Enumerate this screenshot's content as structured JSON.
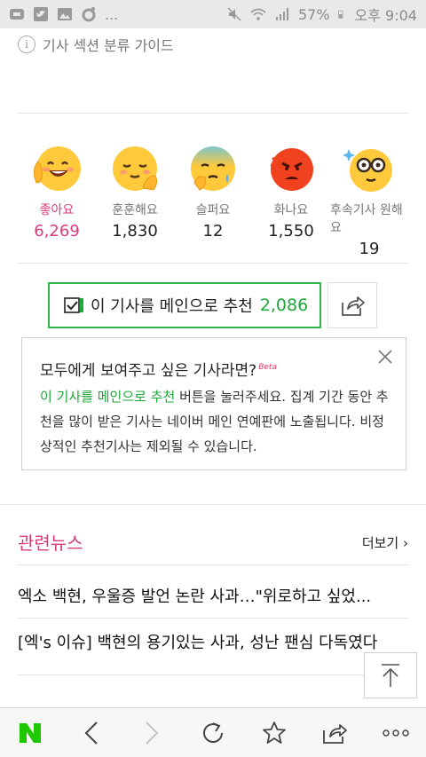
{
  "status_bar": {
    "left_icons": [
      "stick-icon",
      "twitter-icon",
      "image-icon",
      "camera-icon"
    ],
    "ellipsis": "...",
    "battery": "57%",
    "time": "오후 9:04",
    "right_icons": [
      "mute-icon",
      "wifi-icon",
      "signal-icon",
      "battery-icon"
    ]
  },
  "guide": {
    "label": "기사 섹션 분류 가이드"
  },
  "reactions": [
    {
      "label": "좋아요",
      "count": "6,269",
      "icon": "like-face-icon",
      "active": true
    },
    {
      "label": "훈훈해요",
      "count": "1,830",
      "icon": "warm-face-icon",
      "active": false
    },
    {
      "label": "슬퍼요",
      "count": "12",
      "icon": "sad-face-icon",
      "active": false
    },
    {
      "label": "화나요",
      "count": "1,550",
      "icon": "angry-face-icon",
      "active": false
    },
    {
      "label": "후속기사 원해요",
      "count": "19",
      "icon": "glasses-face-icon",
      "active": false
    }
  ],
  "recommend": {
    "label": "이 기사를 메인으로 추천",
    "count": "2,086"
  },
  "info_box": {
    "title": "모두에게 보여주고 싶은 기사라면?",
    "beta": "Beta",
    "highlight": "이 기사를 메인으로 추천",
    "body": " 버튼을 눌러주세요. 집계 기간 동안 추천을 많이 받은 기사는 네이버 메인 연예판에 노출됩니다. 비정상적인 추천기사는 제외될 수 있습니다."
  },
  "related": {
    "title": "관련뉴스",
    "more": "더보기",
    "items": [
      "엑소 백현, 우울증 발언 논란 사과…\"위로하고 싶었...",
      "[엑's 이슈] 백현의 용기있는 사과, 성난 팬심 다독였다"
    ]
  },
  "colors": {
    "accent_pink": "#d93c7b",
    "accent_green": "#1ea83a",
    "naver_green": "#1ec800"
  },
  "bottom_nav": [
    "naver-home-icon",
    "back-icon",
    "forward-icon",
    "refresh-icon",
    "bookmark-icon",
    "share-icon",
    "more-icon"
  ]
}
